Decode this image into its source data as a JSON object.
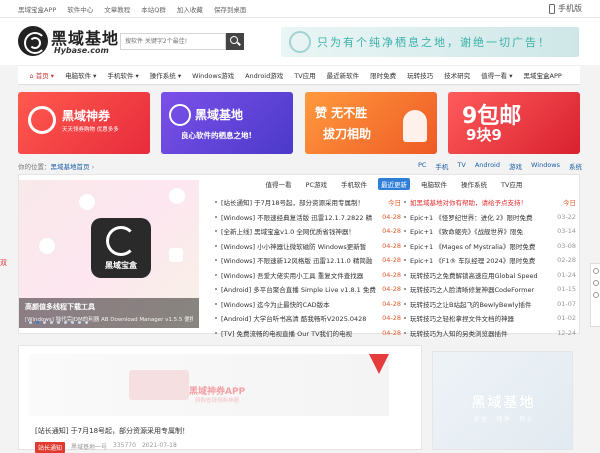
{
  "topbar": {
    "links": [
      "黑域宝盒APP",
      "软件中心",
      "文章教程",
      "本站Q群",
      "加入收藏",
      "保存到桌面"
    ],
    "mobile_label": "手机版"
  },
  "header": {
    "logo_name": "黑域基地",
    "logo_domain": "Hybase.com",
    "search_placeholder": "搜软件 关键字2个最佳!",
    "slogan": "只为有个纯净栖息之地，谢绝一切广告！"
  },
  "nav": {
    "items": [
      "首页",
      "电脑软件",
      "手机软件",
      "操作系统",
      "Windows游戏",
      "Android游戏",
      "TV应用",
      "最近新软件",
      "限时免费",
      "玩转技巧",
      "技术研究",
      "值得一看",
      "黑域宝盒APP"
    ]
  },
  "promo_cards": [
    {
      "big": "黑域神券",
      "small": "天天领券购物 优惠多多"
    },
    {
      "big": "黑域基地",
      "small": "良心软件的栖息之地!"
    },
    {
      "big": "赞 无不胜",
      "small": "拔刀相助"
    },
    {
      "big": "9包邮",
      "small": "9块9"
    }
  ],
  "breadcrumb": {
    "prefix": "你的位置：",
    "current": "黑域基地首页",
    "sep": "›"
  },
  "category_links": [
    "PC",
    "手机",
    "TV",
    "Android",
    "游戏",
    "Windows",
    "系统"
  ],
  "slide": {
    "app_label": "黑域宝盒",
    "caption_title": "高颜值多线程下载工具",
    "caption_desc": "[Windows] 独代完IDM的利器 AB Download Manager v1.5.5 便携版"
  },
  "tabs": [
    "值得一看",
    "PC游戏",
    "手机软件",
    "最近更新",
    "电脑软件",
    "操作系统",
    "TV应用"
  ],
  "active_tab": "最近更新",
  "left_list": [
    {
      "title": "[站长通知] 于7月18号起，部分资源采用专属制！",
      "date": "今日"
    },
    {
      "title": "[Windows] 不限速经典复活版 迅雷12.1.7.2822 精",
      "date": "04-28"
    },
    {
      "title": "[全新上线] 黑域宝盒v1.0 全网优质省钱神器！",
      "date": "04-28"
    },
    {
      "title": "[Windows] 小小神器让微软磁防 Windows更新暂",
      "date": "04-28"
    },
    {
      "title": "[Windows] 不限速新12风格版 迅雷12.11.0 精简融",
      "date": "04-28"
    },
    {
      "title": "[Windows] 吾爱大佬实用小工具 重复文件查找器",
      "date": "04-28"
    },
    {
      "title": "[Android] 多平台聚合直播 Simple Live v1.8.1 免费",
      "date": "04-28"
    },
    {
      "title": "[Windows] 迄今为止最快的CAD版本",
      "date": "04-28"
    },
    {
      "title": "[Android] 大学台听书高清 酷我畅听V2025.0428",
      "date": "04-28"
    },
    {
      "title": "[TV] 免费流畅的电视直播 Our TV我们的电视",
      "date": "04-28"
    }
  ],
  "right_list": [
    {
      "title": "如黑域基地对你有帮助，请给予点支持！",
      "date": "今日"
    },
    {
      "title": "Epic+1 《怪罗纪世界：进化 2》限时免费",
      "date": "03-22"
    },
    {
      "title": "Epic+1 《致命躯壳》《战舰世界》限免",
      "date": "03-14"
    },
    {
      "title": "Epic+1 《Mages of Mystralia》限时免费",
      "date": "03-08"
    },
    {
      "title": "Epic+1 《F1® 车队经理 2024》限时免费",
      "date": "02-28"
    },
    {
      "title": "玩转技巧之免费解锁高速应用Global Speed",
      "date": "01-24"
    },
    {
      "title": "玩转技巧之人脸清晰修复神器CodeFormer",
      "date": "01-15"
    },
    {
      "title": "玩转技巧之让B站起飞的BewlyBewly插件",
      "date": "01-07"
    },
    {
      "title": "玩转技巧之轻松拿捏文件文档的神器",
      "date": "01-02"
    },
    {
      "title": "玩转技巧为人知的另类浏览器插件",
      "date": "12-24"
    }
  ],
  "bottom_banner": {
    "app_name": "黑域神券APP",
    "sub": "网购省钱领券神器"
  },
  "notice": {
    "title": "[站长通知] 于7月18号起，部分资源采用专属制！",
    "badge": "站长通知",
    "author": "黑域基地一号",
    "views": "335770",
    "date": "2021-07-18"
  },
  "bottom_right": {
    "brand": "黑域基地",
    "tag": "安全 · 纯净 · 良心"
  },
  "left_edge_text": "双"
}
